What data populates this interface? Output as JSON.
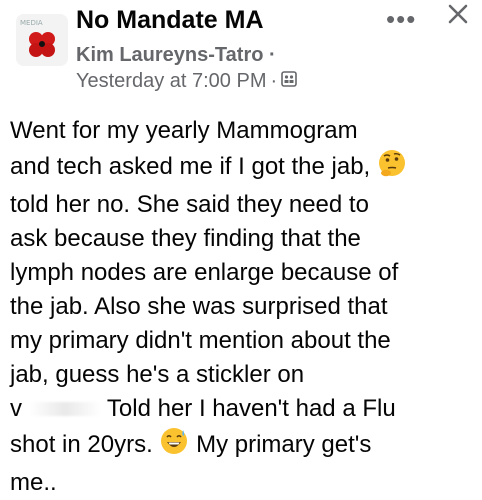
{
  "header": {
    "group_name": "No Mandate MA",
    "author": "Kim Laureyns-Tatro",
    "author_separator": "·",
    "timestamp": "Yesterday at 7:00 PM",
    "timestamp_separator": "·",
    "more_icon": "more-dots-icon",
    "close_icon": "close-icon",
    "audience_icon": "group-audience-icon"
  },
  "post": {
    "lines": [
      "Went for my yearly Mammogram",
      "and tech asked me if I got the jab,",
      "told her no. She said they need to",
      "ask because they finding that the",
      "lymph nodes are enlarge because of",
      "the jab. Also she was surprised that",
      "my primary didn't mention about the",
      "jab, guess he's a stickler on",
      "v",
      "Told her I haven't had a Flu",
      "shot in 20yrs.",
      "My primary get's",
      "me.."
    ]
  }
}
